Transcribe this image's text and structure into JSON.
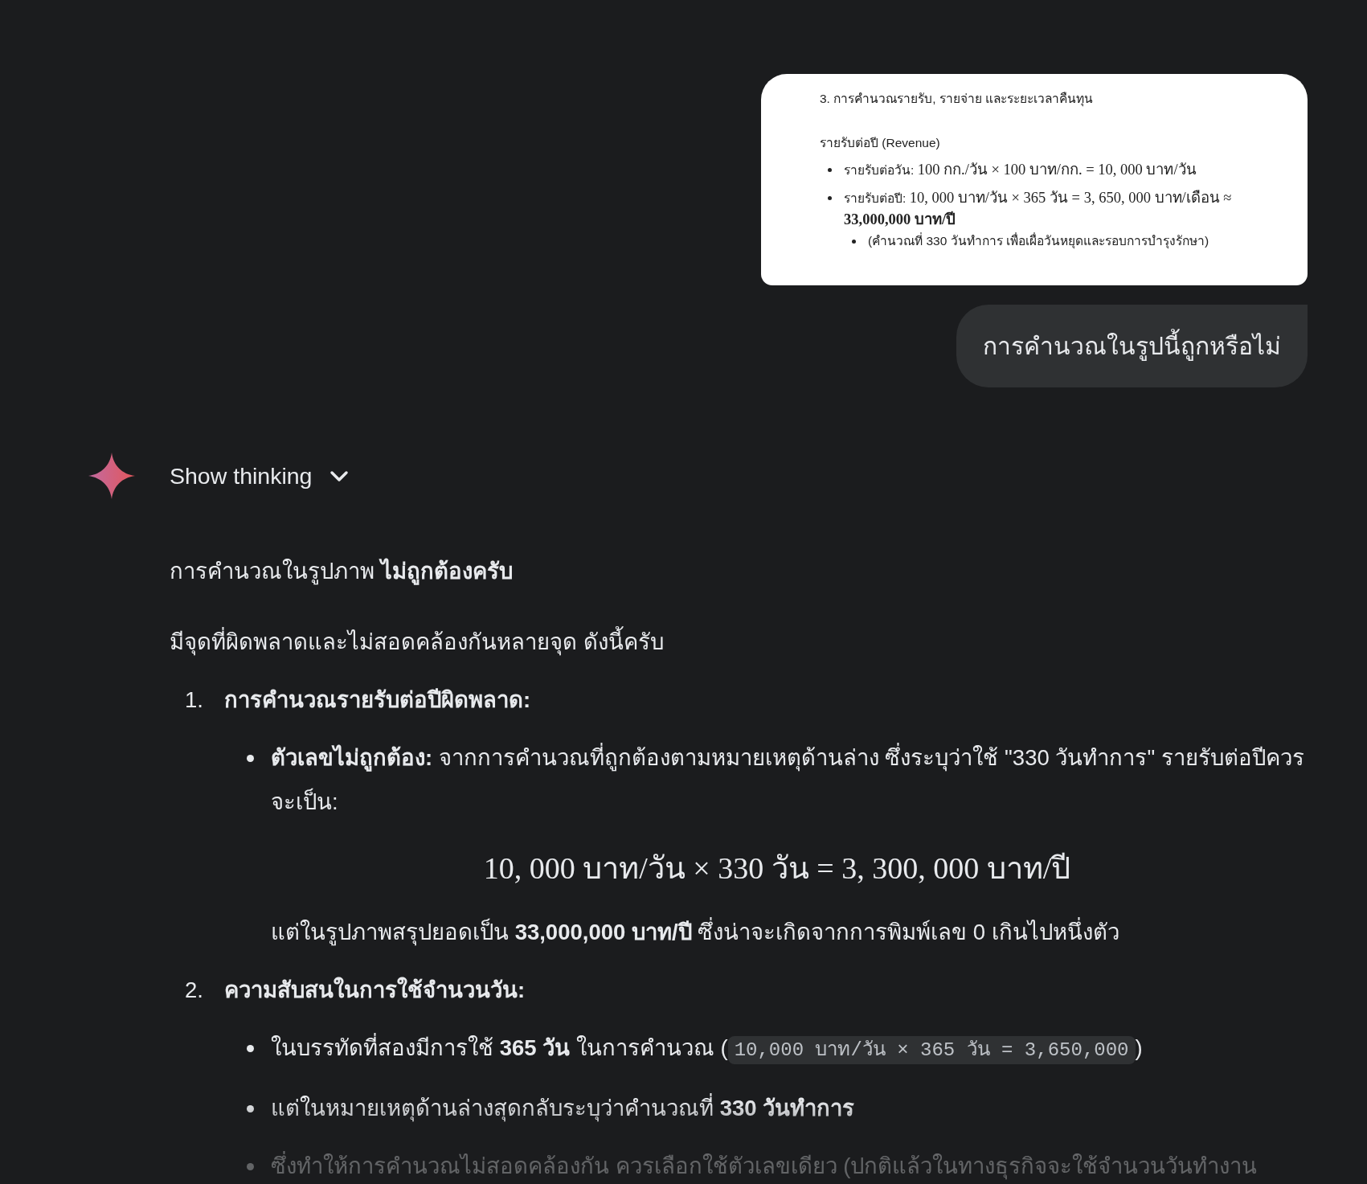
{
  "attachment": {
    "heading": "3. การคำนวณรายรับ, รายจ่าย และระยะเวลาคืนทุน",
    "subheading": "รายรับต่อปี (Revenue)",
    "items": [
      {
        "label": "รายรับต่อวัน:",
        "formula": "100 กก./วัน × 100 บาท/กก. = 10, 000 บาท/วัน"
      },
      {
        "label": "รายรับต่อปี:",
        "formula": "10, 000 บาท/วัน × 365 วัน = 3, 650, 000 บาท/เดือน ≈ **33,000,000 บาท/ปี**",
        "sub": [
          "(คำนวณที่ 330 วันทำการ เพื่อเผื่อวันหยุดและรอบการบำรุงรักษา)"
        ]
      }
    ]
  },
  "user_message": "การคำนวณในรูปนี้ถูกหรือไม่",
  "response": {
    "thinking_label": "Show thinking",
    "expanded": false,
    "paragraphs": [
      "การคำนวณในรูปภาพ **ไม่ถูกต้องครับ**",
      "มีจุดที่ผิดพลาดและไม่สอดคล้องกันหลายจุด ดังนี้ครับ"
    ],
    "list": [
      {
        "number": "1.",
        "title": "การคำนวณรายรับต่อปีผิดพลาด:",
        "blocks": [
          {
            "kind": "bullet",
            "text": "**ตัวเลขไม่ถูกต้อง:** จากการคำนวณที่ถูกต้องตามหมายเหตุด้านล่าง ซึ่งระบุว่าใช้ \"330 วันทำการ\" รายรับต่อปีควรจะเป็น:"
          },
          {
            "kind": "math",
            "text": "10, 000 บาท/วัน × 330 วัน = 3, 300, 000 บาท/ปี"
          },
          {
            "kind": "text",
            "text": "แต่ในรูปภาพสรุปยอดเป็น **33,000,000 บาท/ปี** ซึ่งน่าจะเกิดจากการพิมพ์เลข 0 เกินไปหนึ่งตัว"
          }
        ]
      },
      {
        "number": "2.",
        "title": "ความสับสนในการใช้จำนวนวัน:",
        "blocks": [
          {
            "kind": "bullet",
            "text": "ในบรรทัดที่สองมีการใช้ **365 วัน** ในการคำนวณ (",
            "code": "10,000 บาท/วัน × 365 วัน = 3,650,000",
            "text_after": ")"
          },
          {
            "kind": "bullet",
            "text": "แต่ในหมายเหตุด้านล่างสุดกลับระบุว่าคำนวณที่ **330 วันทำการ**"
          },
          {
            "kind": "bullet",
            "text": "ซึ่งทำให้การคำนวณไม่สอดคล้องกัน ควรเลือกใช้ตัวเลขเดียว (ปกติแล้วในทางธุรกิจจะใช้จำนวนวันทำงาน"
          }
        ]
      }
    ]
  }
}
